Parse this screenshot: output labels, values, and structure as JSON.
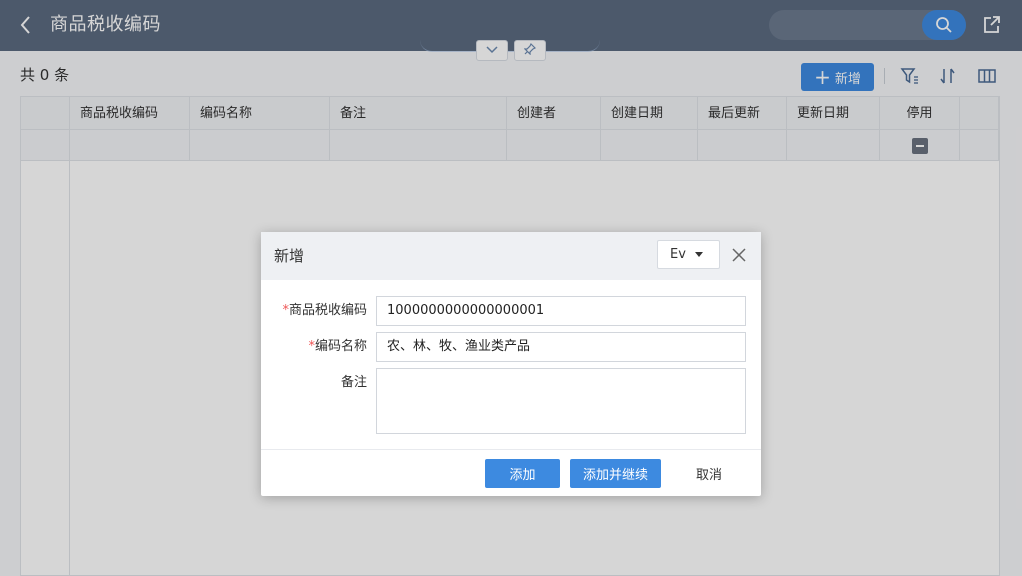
{
  "header": {
    "title": "商品税收编码",
    "search_placeholder": ""
  },
  "toolbar": {
    "record_count": "共 0 条",
    "add_label": "新增"
  },
  "table": {
    "columns": [
      "商品税收编码",
      "编码名称",
      "备注",
      "创建者",
      "创建日期",
      "最后更新",
      "更新日期",
      "停用"
    ]
  },
  "dialog": {
    "title": "新增",
    "language": "Ev",
    "fields": {
      "code_label": "商品税收编码",
      "code_value": "1000000000000000001",
      "name_label": "编码名称",
      "name_value": "农、林、牧、渔业类产品",
      "note_label": "备注",
      "note_value": ""
    },
    "required_mark": "*",
    "buttons": {
      "add": "添加",
      "add_continue": "添加并继续",
      "cancel": "取消"
    }
  },
  "colors": {
    "header_bg": "#5b6a80",
    "primary": "#3d8ae0",
    "required": "#e55555"
  }
}
